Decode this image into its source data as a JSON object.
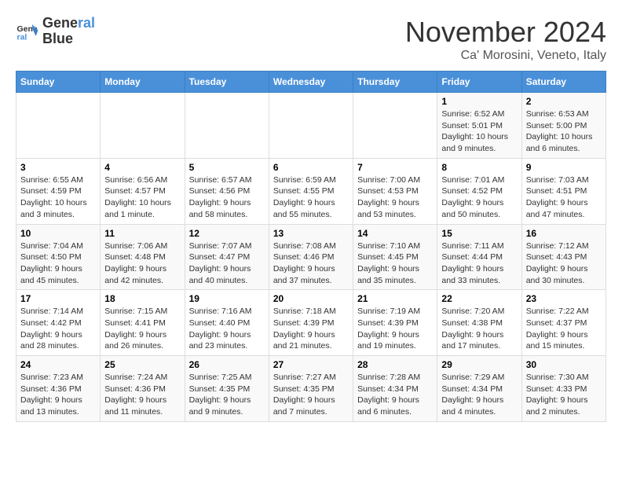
{
  "header": {
    "logo_line1": "General",
    "logo_line2": "Blue",
    "month_title": "November 2024",
    "subtitle": "Ca' Morosini, Veneto, Italy"
  },
  "days_of_week": [
    "Sunday",
    "Monday",
    "Tuesday",
    "Wednesday",
    "Thursday",
    "Friday",
    "Saturday"
  ],
  "weeks": [
    [
      {
        "day": "",
        "info": ""
      },
      {
        "day": "",
        "info": ""
      },
      {
        "day": "",
        "info": ""
      },
      {
        "day": "",
        "info": ""
      },
      {
        "day": "",
        "info": ""
      },
      {
        "day": "1",
        "info": "Sunrise: 6:52 AM\nSunset: 5:01 PM\nDaylight: 10 hours and 9 minutes."
      },
      {
        "day": "2",
        "info": "Sunrise: 6:53 AM\nSunset: 5:00 PM\nDaylight: 10 hours and 6 minutes."
      }
    ],
    [
      {
        "day": "3",
        "info": "Sunrise: 6:55 AM\nSunset: 4:59 PM\nDaylight: 10 hours and 3 minutes."
      },
      {
        "day": "4",
        "info": "Sunrise: 6:56 AM\nSunset: 4:57 PM\nDaylight: 10 hours and 1 minute."
      },
      {
        "day": "5",
        "info": "Sunrise: 6:57 AM\nSunset: 4:56 PM\nDaylight: 9 hours and 58 minutes."
      },
      {
        "day": "6",
        "info": "Sunrise: 6:59 AM\nSunset: 4:55 PM\nDaylight: 9 hours and 55 minutes."
      },
      {
        "day": "7",
        "info": "Sunrise: 7:00 AM\nSunset: 4:53 PM\nDaylight: 9 hours and 53 minutes."
      },
      {
        "day": "8",
        "info": "Sunrise: 7:01 AM\nSunset: 4:52 PM\nDaylight: 9 hours and 50 minutes."
      },
      {
        "day": "9",
        "info": "Sunrise: 7:03 AM\nSunset: 4:51 PM\nDaylight: 9 hours and 47 minutes."
      }
    ],
    [
      {
        "day": "10",
        "info": "Sunrise: 7:04 AM\nSunset: 4:50 PM\nDaylight: 9 hours and 45 minutes."
      },
      {
        "day": "11",
        "info": "Sunrise: 7:06 AM\nSunset: 4:48 PM\nDaylight: 9 hours and 42 minutes."
      },
      {
        "day": "12",
        "info": "Sunrise: 7:07 AM\nSunset: 4:47 PM\nDaylight: 9 hours and 40 minutes."
      },
      {
        "day": "13",
        "info": "Sunrise: 7:08 AM\nSunset: 4:46 PM\nDaylight: 9 hours and 37 minutes."
      },
      {
        "day": "14",
        "info": "Sunrise: 7:10 AM\nSunset: 4:45 PM\nDaylight: 9 hours and 35 minutes."
      },
      {
        "day": "15",
        "info": "Sunrise: 7:11 AM\nSunset: 4:44 PM\nDaylight: 9 hours and 33 minutes."
      },
      {
        "day": "16",
        "info": "Sunrise: 7:12 AM\nSunset: 4:43 PM\nDaylight: 9 hours and 30 minutes."
      }
    ],
    [
      {
        "day": "17",
        "info": "Sunrise: 7:14 AM\nSunset: 4:42 PM\nDaylight: 9 hours and 28 minutes."
      },
      {
        "day": "18",
        "info": "Sunrise: 7:15 AM\nSunset: 4:41 PM\nDaylight: 9 hours and 26 minutes."
      },
      {
        "day": "19",
        "info": "Sunrise: 7:16 AM\nSunset: 4:40 PM\nDaylight: 9 hours and 23 minutes."
      },
      {
        "day": "20",
        "info": "Sunrise: 7:18 AM\nSunset: 4:39 PM\nDaylight: 9 hours and 21 minutes."
      },
      {
        "day": "21",
        "info": "Sunrise: 7:19 AM\nSunset: 4:39 PM\nDaylight: 9 hours and 19 minutes."
      },
      {
        "day": "22",
        "info": "Sunrise: 7:20 AM\nSunset: 4:38 PM\nDaylight: 9 hours and 17 minutes."
      },
      {
        "day": "23",
        "info": "Sunrise: 7:22 AM\nSunset: 4:37 PM\nDaylight: 9 hours and 15 minutes."
      }
    ],
    [
      {
        "day": "24",
        "info": "Sunrise: 7:23 AM\nSunset: 4:36 PM\nDaylight: 9 hours and 13 minutes."
      },
      {
        "day": "25",
        "info": "Sunrise: 7:24 AM\nSunset: 4:36 PM\nDaylight: 9 hours and 11 minutes."
      },
      {
        "day": "26",
        "info": "Sunrise: 7:25 AM\nSunset: 4:35 PM\nDaylight: 9 hours and 9 minutes."
      },
      {
        "day": "27",
        "info": "Sunrise: 7:27 AM\nSunset: 4:35 PM\nDaylight: 9 hours and 7 minutes."
      },
      {
        "day": "28",
        "info": "Sunrise: 7:28 AM\nSunset: 4:34 PM\nDaylight: 9 hours and 6 minutes."
      },
      {
        "day": "29",
        "info": "Sunrise: 7:29 AM\nSunset: 4:34 PM\nDaylight: 9 hours and 4 minutes."
      },
      {
        "day": "30",
        "info": "Sunrise: 7:30 AM\nSunset: 4:33 PM\nDaylight: 9 hours and 2 minutes."
      }
    ]
  ]
}
